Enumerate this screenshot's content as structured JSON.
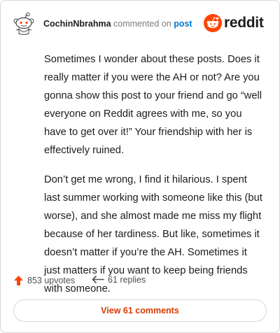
{
  "header": {
    "username": "CochinNbrahma",
    "action": "commented on",
    "post_link": "post",
    "logo_text": "reddit",
    "logo_icon": "reddit-snoo-icon",
    "avatar_icon": "snoo-avatar-icon"
  },
  "comment": {
    "paragraphs": [
      "Sometimes I wonder about these posts. Does it really matter if you were the AH or not? Are you gonna show this post to your friend and go “well everyone on Reddit agrees with me, so you have to get over it!” Your friendship with her is effectively ruined.",
      "Don’t get me wrong, I find it hilarious. I spent last summer working with someone like this (but worse), and she almost made me miss my flight because of her tardiness. But like, sometimes it doesn’t matter if you’re the AH. Sometimes it just matters if you want to keep being friends with someone."
    ]
  },
  "stats": {
    "upvotes": "853 upvotes",
    "replies": "61 replies",
    "upvote_icon": "upvote-arrow-icon",
    "reply_icon": "reply-arrow-icon"
  },
  "footer": {
    "view_button": "View 61 comments"
  },
  "colors": {
    "brand": "#ff4500",
    "link": "#0079d3",
    "button_text": "#d93a00"
  }
}
